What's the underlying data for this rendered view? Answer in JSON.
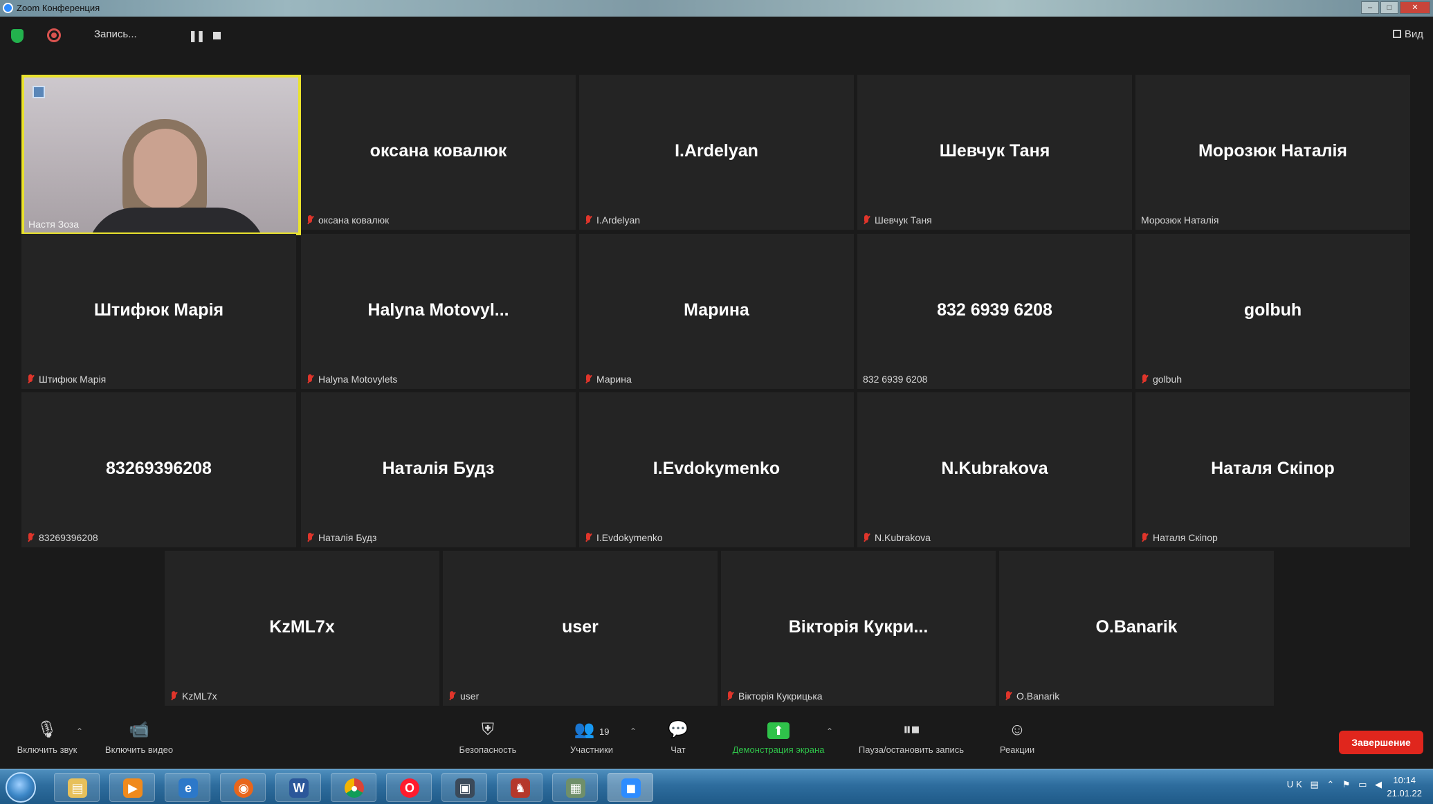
{
  "window": {
    "title": "Zoom Конференция"
  },
  "topbar": {
    "recording_label": "Запись...",
    "view_label": "Вид"
  },
  "gallery": {
    "video_tile": {
      "label": "Настя Зоза"
    },
    "tiles": [
      {
        "name": "оксана ковалюк",
        "label": "оксана ковалюк",
        "muted": true
      },
      {
        "name": "I.Ardelyan",
        "label": "I.Ardelyan",
        "muted": true
      },
      {
        "name": "Шевчук Таня",
        "label": "Шевчук Таня",
        "muted": true
      },
      {
        "name": "Морозюк Наталія",
        "label": "Морозюк Наталія",
        "muted": false
      },
      {
        "name": "Штифюк Марія",
        "label": "Штифюк Марія",
        "muted": true
      },
      {
        "name": "Halyna Motovyl...",
        "label": "Halyna Motovylets",
        "muted": true
      },
      {
        "name": "Марина",
        "label": "Марина",
        "muted": true
      },
      {
        "name": "832 6939 6208",
        "label": "832 6939 6208",
        "muted": false
      },
      {
        "name": "golbuh",
        "label": "golbuh",
        "muted": true
      },
      {
        "name": "83269396208",
        "label": "83269396208",
        "muted": true
      },
      {
        "name": "Наталія Будз",
        "label": "Наталія Будз",
        "muted": true
      },
      {
        "name": "I.Evdokymenko",
        "label": "I.Evdokymenko",
        "muted": true
      },
      {
        "name": "N.Kubrakova",
        "label": "N.Kubrakova",
        "muted": true
      },
      {
        "name": "Наталя Скіпор",
        "label": "Наталя Скіпор",
        "muted": true
      },
      {
        "name": "KzML7x",
        "label": "KzML7x",
        "muted": true
      },
      {
        "name": "user",
        "label": "user",
        "muted": true
      },
      {
        "name": "Вікторія Кукри...",
        "label": "Вікторія Кукрицька",
        "muted": true
      },
      {
        "name": "O.Banarik",
        "label": "O.Banarik",
        "muted": true
      }
    ]
  },
  "toolbar": {
    "unmute": "Включить звук",
    "start_video": "Включить видео",
    "security": "Безопасность",
    "participants": "Участники",
    "participants_count": "19",
    "chat": "Чат",
    "share_screen": "Демонстрация экрана",
    "pause_recording": "Пауза/остановить запись",
    "reactions": "Реакции",
    "end": "Завершение"
  },
  "taskbar": {
    "apps": [
      "explorer",
      "media-player",
      "internet-explorer",
      "firefox",
      "word",
      "chrome",
      "opera",
      "remote-desktop",
      "game",
      "calculator",
      "zoom"
    ],
    "language": "UK",
    "time": "10:14",
    "date": "21.01.22"
  },
  "colors": {
    "active_speaker_border": "#e9e22d",
    "muted_icon": "#e0352b",
    "share_green": "#2fc24a",
    "end_red": "#e0261d"
  }
}
